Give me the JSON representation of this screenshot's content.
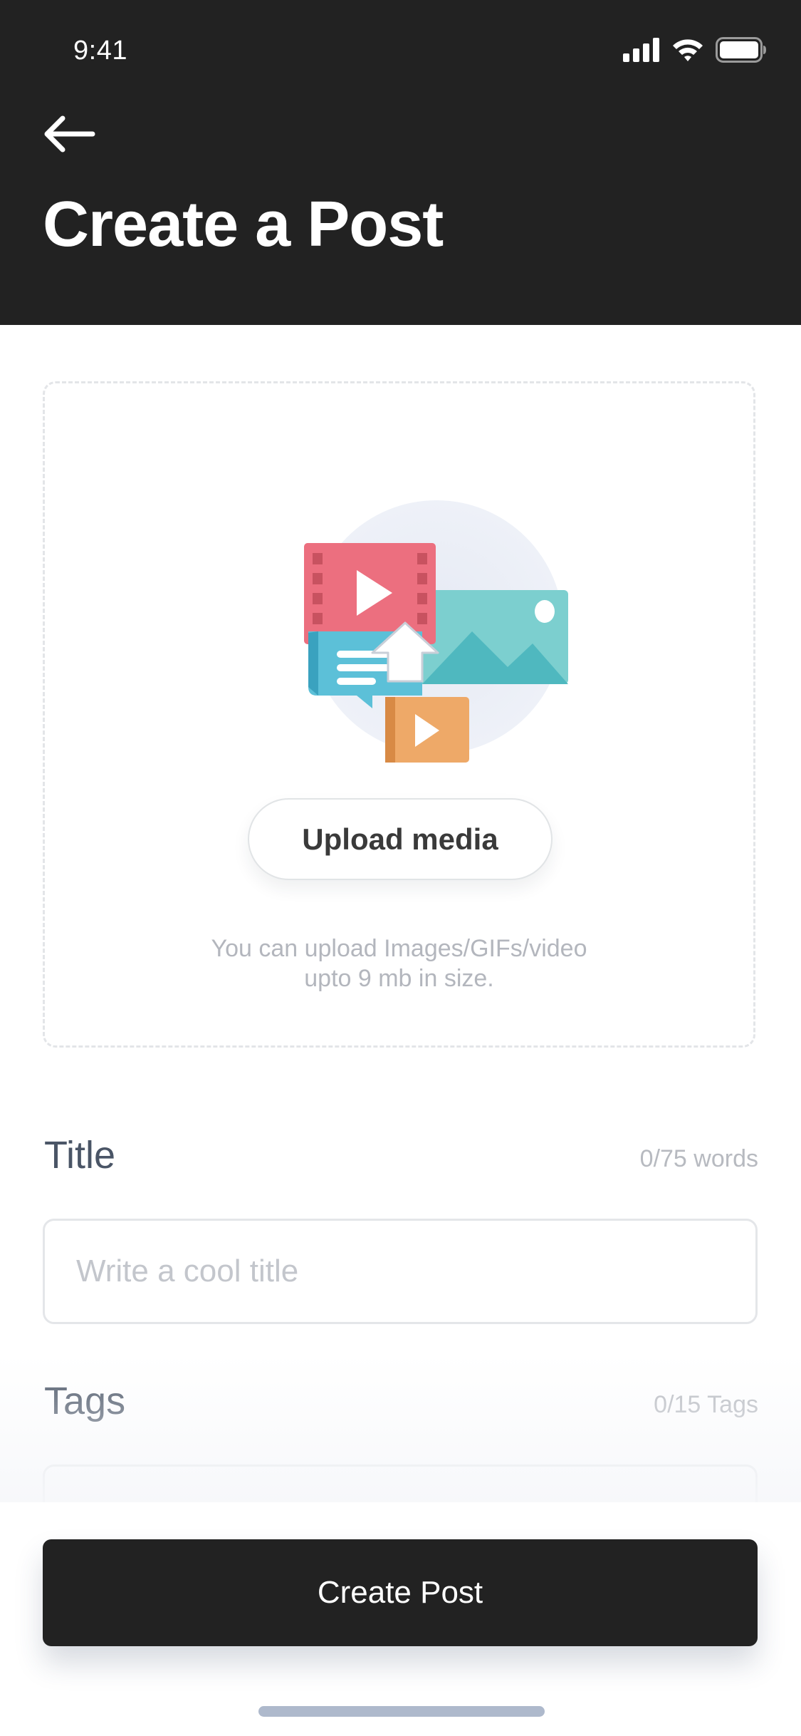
{
  "status_bar": {
    "time": "9:41",
    "icons": [
      "signal-icon",
      "wifi-icon",
      "battery-icon"
    ]
  },
  "header": {
    "back_icon": "arrow-left-icon",
    "title": "Create a Post"
  },
  "upload": {
    "illustration": "media-upload-illustration",
    "button_label": "Upload media",
    "hint_line1": "You can upload Images/GIFs/video",
    "hint_line2": "upto 9 mb in size."
  },
  "form": {
    "title": {
      "label": "Title",
      "counter": "0/75 words",
      "placeholder": "Write a cool title",
      "value": ""
    },
    "tags": {
      "label": "Tags",
      "counter": "0/15 Tags"
    }
  },
  "footer": {
    "create_label": "Create Post"
  },
  "colors": {
    "header_bg": "#222222",
    "primary_button": "#222222",
    "label_text": "#4a5566",
    "muted_text": "#b3b6bd",
    "home_indicator": "#aeb9cc"
  }
}
